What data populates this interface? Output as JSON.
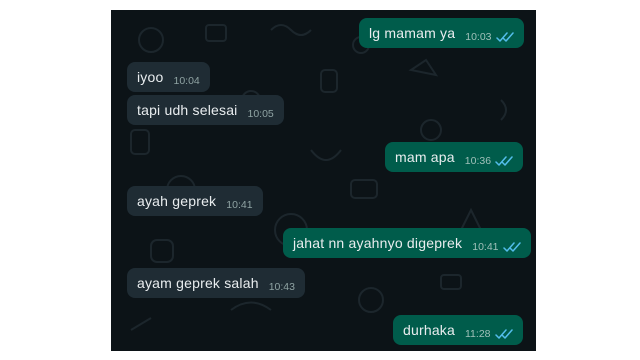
{
  "colors": {
    "chat_background": "#0c1317",
    "outgoing_bubble": "#005c4b",
    "incoming_bubble": "#1f2c34",
    "message_text": "#e9edef",
    "read_ticks": "#53bdeb"
  },
  "messages": [
    {
      "direction": "outgoing",
      "text": "lg mamam ya",
      "time": "10:03",
      "status": "read-ticks-icon"
    },
    {
      "direction": "incoming",
      "text": "iyoo",
      "time": "10:04"
    },
    {
      "direction": "incoming",
      "text": "tapi udh selesai",
      "time": "10:05"
    },
    {
      "direction": "outgoing",
      "text": "mam apa",
      "time": "10:36",
      "status": "read-ticks-icon"
    },
    {
      "direction": "incoming",
      "text": "ayah geprek",
      "time": "10:41"
    },
    {
      "direction": "outgoing",
      "text": "jahat nn ayahnyo digeprek",
      "time": "10:41",
      "status": "read-ticks-icon"
    },
    {
      "direction": "incoming",
      "text": "ayam geprek salah",
      "time": "10:43"
    },
    {
      "direction": "outgoing",
      "text": "durhaka",
      "time": "11:28",
      "status": "read-ticks-icon"
    }
  ]
}
